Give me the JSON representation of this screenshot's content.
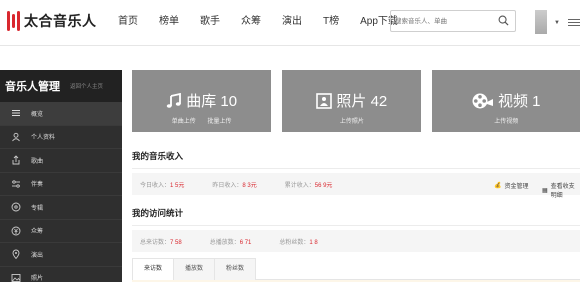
{
  "brand": {
    "name": "太合音乐人",
    "color": "#d9282f"
  },
  "nav": [
    "首页",
    "榜单",
    "歌手",
    "众筹",
    "演出",
    "T榜",
    "App下载"
  ],
  "search": {
    "placeholder": "搜索音乐人、单曲",
    "icon": "search-icon"
  },
  "sidebar": {
    "title": "音乐人管理",
    "back": "返回个人主页",
    "items": [
      {
        "label": "概览",
        "icon": "list-icon"
      },
      {
        "label": "个人资料",
        "icon": "user-icon"
      },
      {
        "label": "歌曲",
        "icon": "upload-icon"
      },
      {
        "label": "伴奏",
        "icon": "sliders-icon"
      },
      {
        "label": "专辑",
        "icon": "disc-icon"
      },
      {
        "label": "众筹",
        "icon": "fund-icon"
      },
      {
        "label": "演出",
        "icon": "location-icon"
      },
      {
        "label": "照片",
        "icon": "image-icon"
      }
    ]
  },
  "tiles": [
    {
      "icon": "music-note-icon",
      "label": "曲库 10",
      "actions": [
        "单曲上传",
        "批量上传"
      ]
    },
    {
      "icon": "photo-icon",
      "label": "照片 42",
      "actions": [
        "上传照片"
      ]
    },
    {
      "icon": "film-reel-icon",
      "label": "视频 1",
      "actions": [
        "上传视频"
      ]
    }
  ],
  "income": {
    "title": "我的音乐收入",
    "stats": [
      {
        "label": "今日收入：",
        "value": "1   5元"
      },
      {
        "label": "昨日收入：",
        "value": "8   3元"
      },
      {
        "label": "累计收入：",
        "value": "56   9元"
      }
    ],
    "actions": [
      {
        "label": "资金管理",
        "icon": "money-bag-icon"
      },
      {
        "label": "查看收支明细",
        "icon": "chart-icon"
      }
    ]
  },
  "visits": {
    "title": "我的访问统计",
    "stats": [
      {
        "label": "总来访数：",
        "value": "7   58"
      },
      {
        "label": "总播放数：",
        "value": "6   71"
      },
      {
        "label": "总粉丝数：",
        "value": "1   8"
      }
    ],
    "tabs": [
      "来访数",
      "播放数",
      "粉丝数"
    ]
  }
}
